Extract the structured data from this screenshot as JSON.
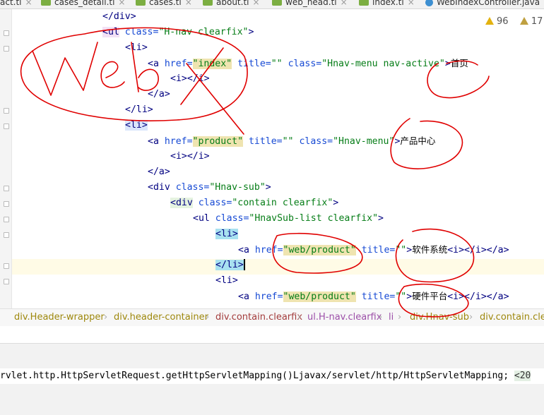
{
  "tabs": [
    {
      "label": "act.tl",
      "active": false
    },
    {
      "label": "cases_detail.tl",
      "active": false
    },
    {
      "label": "cases.tl",
      "active": false
    },
    {
      "label": "about.tl",
      "active": false
    },
    {
      "label": "web_head.tl",
      "active": true
    },
    {
      "label": "index.tl",
      "active": false
    },
    {
      "label": "WebIndexController.java",
      "active": false
    }
  ],
  "inspections": {
    "warnings": "96",
    "weak_warnings": "17"
  },
  "code": {
    "l1": {
      "close_div": "</div>"
    },
    "l2": {
      "open": "<ul",
      "attr": "class=",
      "val": "\"H-nav clearfix\"",
      "close": ">"
    },
    "l3": {
      "li": "<li>"
    },
    "l4": {
      "open": "<a",
      "href": "href=",
      "href_val": "\"index\"",
      "title": "title=",
      "title_val": "\"\"",
      "cls": "class=",
      "cls_val": "\"Hnav-menu nav-active\"",
      "gt": ">",
      "text": "首页"
    },
    "l5": {
      "i": "<i></i>"
    },
    "l6": {
      "close_a": "</a>"
    },
    "l7": {
      "close_li": "</li>"
    },
    "l8": {
      "li": "<li>"
    },
    "l9": {
      "open": "<a",
      "href": "href=",
      "href_val": "\"product\"",
      "title": "title=",
      "title_val": "\"\"",
      "cls": "class=",
      "cls_val": "\"Hnav-menu\"",
      "gt": ">",
      "text": "产品中心"
    },
    "l10": {
      "i": "<i></i>"
    },
    "l11": {
      "close_a": "</a>"
    },
    "l12": {
      "open": "<div",
      "cls": "class=",
      "cls_val": "\"Hnav-sub\"",
      "gt": ">"
    },
    "l13": {
      "open": "<div",
      "cls": "class=",
      "cls_val": "\"contain clearfix\"",
      "gt": ">"
    },
    "l14": {
      "open": "<ul",
      "cls": "class=",
      "cls_val": "\"HnavSub-list clearfix\"",
      "gt": ">"
    },
    "l15": {
      "li": "<li>"
    },
    "l16": {
      "open": "<a",
      "href": "href=",
      "href_val": "\"web/product\"",
      "title": "title=",
      "title_val": "\"\"",
      "gt": ">",
      "text": "软件系统",
      "tail": "<i></i></a>"
    },
    "l17": {
      "close_li": "</li>"
    },
    "l18": {
      "li": "<li>"
    },
    "l19": {
      "open": "<a",
      "href": "href=",
      "href_val": "\"web/product\"",
      "title": "title=",
      "title_val": "\"\"",
      "gt": ">",
      "text": "硬件平台",
      "tail": "<i></i></a>"
    }
  },
  "breadcrumb": [
    {
      "label": "div.Header-wrapper"
    },
    {
      "label": "div.header-container"
    },
    {
      "label": "div.contain.clearfix"
    },
    {
      "label": "ul.H-nav.clearfix"
    },
    {
      "label": "li"
    },
    {
      "label": "div.Hnav-sub"
    },
    {
      "label": "div.contain.clearfix"
    }
  ],
  "console": {
    "line": "rvlet.http.HttpServletRequest.getHttpServletMapping()Ljavax/servlet/http/HttpServletMapping; ",
    "end": "<20"
  },
  "annotation": {
    "text": "Web",
    "color": "#e00000"
  }
}
